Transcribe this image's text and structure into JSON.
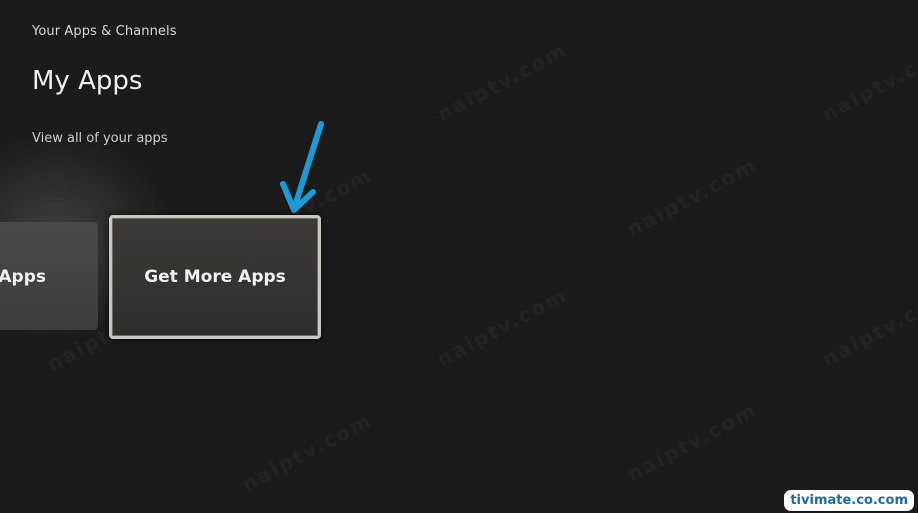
{
  "header": {
    "breadcrumb": "Your Apps & Channels",
    "title": "My Apps",
    "subtitle": "View all of your apps"
  },
  "tiles": {
    "left_label": "y Apps",
    "focused_label": "Get More Apps"
  },
  "annotation": {
    "arrow_color": "#1e9bd7",
    "site_badge": "tivimate.co.com"
  },
  "watermark": {
    "text": "naiptv.com"
  },
  "colors": {
    "background": "#1b1b1c",
    "focus_border": "#c9c7bf",
    "badge_text": "#1f6aa5"
  }
}
